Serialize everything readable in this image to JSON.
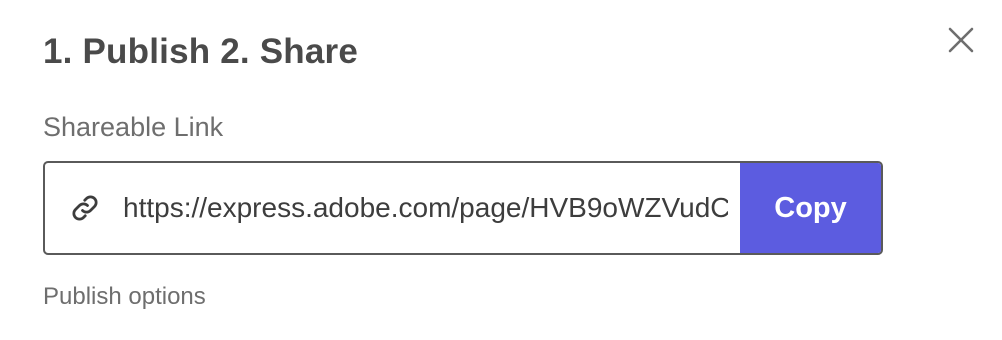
{
  "dialog": {
    "title": "1. Publish 2. Share",
    "close_icon": "close-icon"
  },
  "share": {
    "label": "Shareable Link",
    "link_icon": "link-icon",
    "url_value": "https://express.adobe.com/page/HVB9oWZVudC",
    "copy_label": "Copy"
  },
  "publish": {
    "options_label": "Publish options"
  },
  "colors": {
    "accent": "#5c5ce0",
    "title_text": "#4a4a4a",
    "label_text": "#6e6e6e",
    "field_border": "#5a5a5a"
  }
}
